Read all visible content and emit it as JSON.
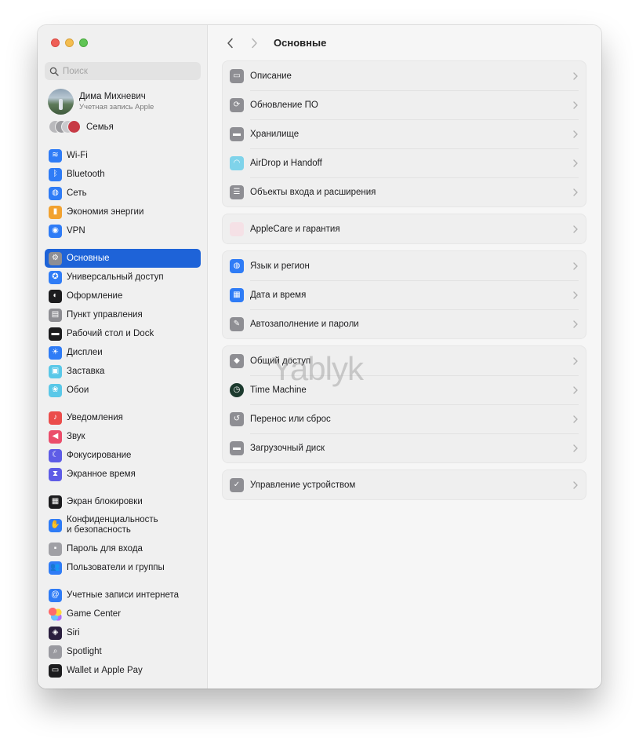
{
  "window": {
    "title": "Основные",
    "traffic_lights": [
      "close",
      "minimize",
      "zoom"
    ]
  },
  "sidebar": {
    "search_placeholder": "Поиск",
    "account": {
      "name": "Дима Михневич",
      "subtitle": "Учетная запись Apple"
    },
    "family_label": "Семья",
    "groups": [
      {
        "items": [
          {
            "label": "Wi-Fi",
            "icon": "wifi-icon",
            "color": "#2f7cf6",
            "glyph": "≋"
          },
          {
            "label": "Bluetooth",
            "icon": "bluetooth-icon",
            "color": "#2f7cf6",
            "glyph": "ᛒ"
          },
          {
            "label": "Сеть",
            "icon": "globe-icon",
            "color": "#2f7cf6",
            "glyph": "◍"
          },
          {
            "label": "Экономия энергии",
            "icon": "battery-icon",
            "color": "#f2a230",
            "glyph": "▮"
          },
          {
            "label": "VPN",
            "icon": "vpn-icon",
            "color": "#2f7cf6",
            "glyph": "◉"
          }
        ]
      },
      {
        "items": [
          {
            "label": "Основные",
            "icon": "gear-icon",
            "color": "#8e8e93",
            "glyph": "⚙",
            "active": true
          },
          {
            "label": "Универсальный доступ",
            "icon": "accessibility-icon",
            "color": "#2f7cf6",
            "glyph": "✪"
          },
          {
            "label": "Оформление",
            "icon": "appearance-icon",
            "color": "#1c1c1e",
            "glyph": "◐"
          },
          {
            "label": "Пункт управления",
            "icon": "control-center-icon",
            "color": "#8e8e93",
            "glyph": "▤"
          },
          {
            "label": "Рабочий стол и Dock",
            "icon": "desktop-dock-icon",
            "color": "#1c1c1e",
            "glyph": "▬"
          },
          {
            "label": "Дисплеи",
            "icon": "displays-icon",
            "color": "#2f7cf6",
            "glyph": "☀"
          },
          {
            "label": "Заставка",
            "icon": "screensaver-icon",
            "color": "#5ac8e8",
            "glyph": "▣"
          },
          {
            "label": "Обои",
            "icon": "wallpaper-icon",
            "color": "#5ac8e8",
            "glyph": "❀"
          }
        ]
      },
      {
        "items": [
          {
            "label": "Уведомления",
            "icon": "bell-icon",
            "color": "#eb4d4b",
            "glyph": "♪"
          },
          {
            "label": "Звук",
            "icon": "speaker-icon",
            "color": "#eb4d6b",
            "glyph": "◀"
          },
          {
            "label": "Фокусирование",
            "icon": "moon-icon",
            "color": "#5e5ce6",
            "glyph": "☾"
          },
          {
            "label": "Экранное время",
            "icon": "hourglass-icon",
            "color": "#5e5ce6",
            "glyph": "⧗"
          }
        ]
      },
      {
        "items": [
          {
            "label": "Экран блокировки",
            "icon": "lock-screen-icon",
            "color": "#1c1c1e",
            "glyph": "▦"
          },
          {
            "label": "Конфиденциальность\nи безопасность",
            "icon": "hand-icon",
            "color": "#2f7cf6",
            "glyph": "✋",
            "tall": true
          },
          {
            "label": "Пароль для входа",
            "icon": "lock-icon",
            "color": "#a0a0a5",
            "glyph": "▪"
          },
          {
            "label": "Пользователи и группы",
            "icon": "users-icon",
            "color": "#2f7cf6",
            "glyph": "👥"
          }
        ]
      },
      {
        "items": [
          {
            "label": "Учетные записи интернета",
            "icon": "at-icon",
            "color": "#2f7cf6",
            "glyph": "@"
          },
          {
            "label": "Game Center",
            "icon": "game-center-icon",
            "color": "#ffffff",
            "glyph": "●",
            "multicolor": true
          },
          {
            "label": "Siri",
            "icon": "siri-icon",
            "color": "#2a1e3e",
            "glyph": "◈"
          },
          {
            "label": "Spotlight",
            "icon": "magnifier-icon",
            "color": "#9a9aa0",
            "glyph": "⌕"
          },
          {
            "label": "Wallet и Apple Pay",
            "icon": "wallet-icon",
            "color": "#1c1c1e",
            "glyph": "▭"
          }
        ]
      }
    ]
  },
  "content": {
    "title": "Основные",
    "back_label": "Назад",
    "forward_label": "Вперед",
    "groups": [
      {
        "rows": [
          {
            "label": "Описание",
            "icon": "about-icon",
            "color": "#8e8e93",
            "glyph": "▭"
          },
          {
            "label": "Обновление ПО",
            "icon": "software-update-icon",
            "color": "#8e8e93",
            "glyph": "⟳"
          },
          {
            "label": "Хранилище",
            "icon": "storage-icon",
            "color": "#8e8e93",
            "glyph": "▬"
          },
          {
            "label": "AirDrop и Handoff",
            "icon": "airdrop-icon",
            "color": "#7fd3ea",
            "glyph": "◠"
          },
          {
            "label": "Объекты входа и расширения",
            "icon": "login-items-icon",
            "color": "#8e8e93",
            "glyph": "☰"
          }
        ]
      },
      {
        "rows": [
          {
            "label": "AppleCare и гарантия",
            "icon": "applecare-icon",
            "color": "#f5e1e6",
            "glyph": "",
            "glyph_color": "#e85a7a"
          }
        ]
      },
      {
        "rows": [
          {
            "label": "Язык и регион",
            "icon": "language-globe-icon",
            "color": "#2f7cf6",
            "glyph": "◍"
          },
          {
            "label": "Дата и время",
            "icon": "calendar-clock-icon",
            "color": "#2f7cf6",
            "glyph": "▦"
          },
          {
            "label": "Автозаполнение и пароли",
            "icon": "autofill-icon",
            "color": "#8e8e93",
            "glyph": "✎"
          }
        ]
      },
      {
        "rows": [
          {
            "label": "Общий доступ",
            "icon": "sharing-icon",
            "color": "#8e8e93",
            "glyph": "◆"
          },
          {
            "label": "Time Machine",
            "icon": "time-machine-icon",
            "color": "#1c3a2e",
            "glyph": "◷",
            "round": true
          },
          {
            "label": "Перенос или сброс",
            "icon": "transfer-reset-icon",
            "color": "#8e8e93",
            "glyph": "↺"
          },
          {
            "label": "Загрузочный диск",
            "icon": "startup-disk-icon",
            "color": "#8e8e93",
            "glyph": "▬"
          }
        ]
      },
      {
        "rows": [
          {
            "label": "Управление устройством",
            "icon": "device-management-icon",
            "color": "#8e8e93",
            "glyph": "✓"
          }
        ]
      }
    ]
  },
  "watermark": "Yablyk"
}
